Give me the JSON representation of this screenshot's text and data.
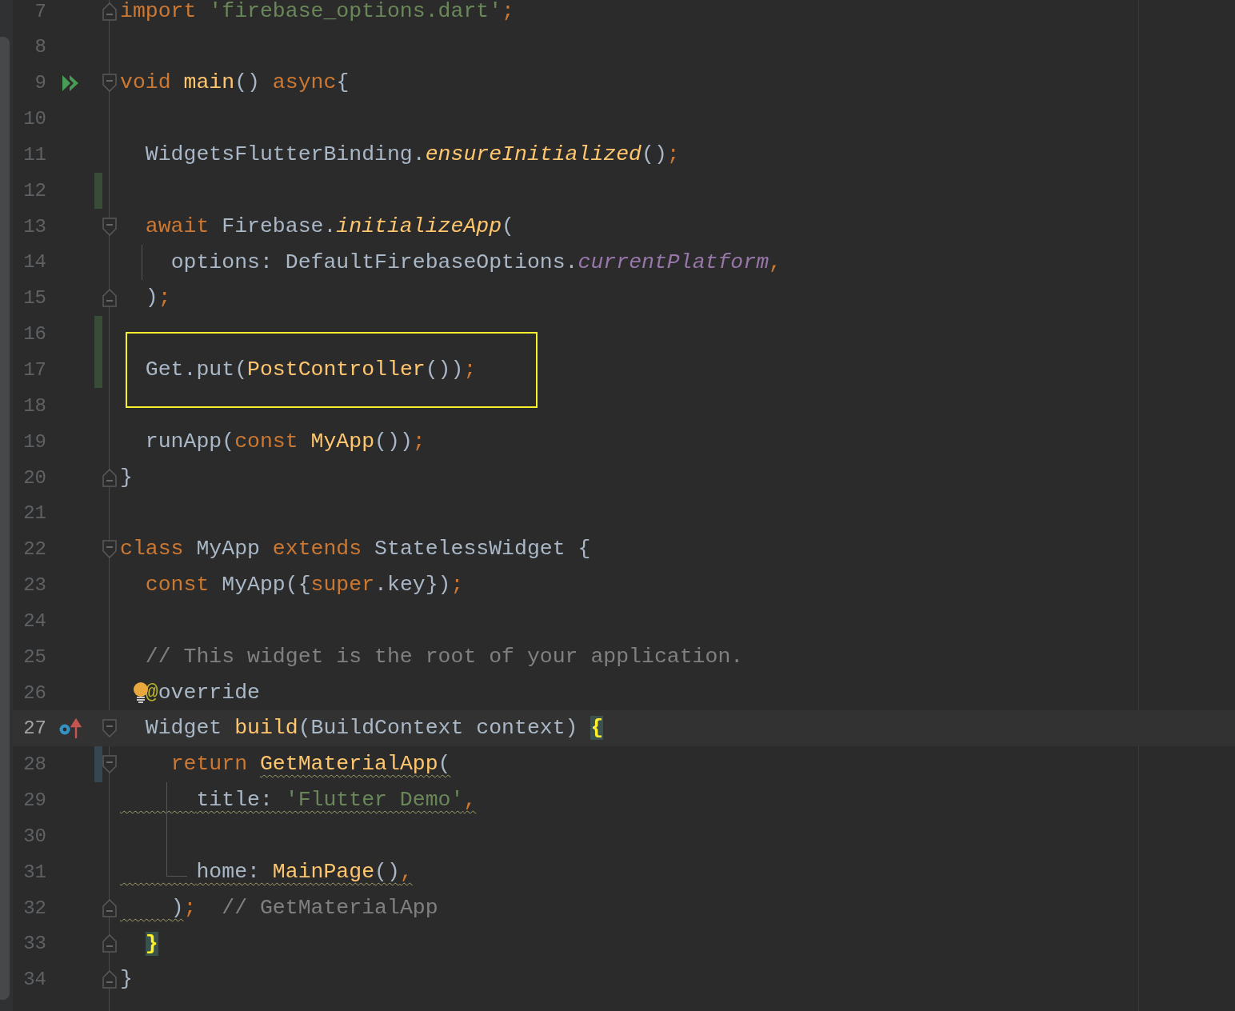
{
  "editor": {
    "lines": [
      {
        "number": "7",
        "current": false,
        "boxed": false,
        "fold": {
          "kind": "end"
        },
        "tokens": [
          {
            "kind": "keyword",
            "text": "import"
          },
          {
            "kind": "string",
            "text": " 'firebase_options.dart'"
          },
          {
            "kind": "keyword",
            "text": ";"
          }
        ]
      },
      {
        "number": "8",
        "current": false,
        "boxed": false
      },
      {
        "number": "9",
        "current": false,
        "boxed": false,
        "fold": {
          "kind": "start"
        },
        "gutter_icon": {
          "kind": "run"
        },
        "tokens": [
          {
            "kind": "keyword",
            "text": "void"
          },
          {
            "kind": "function",
            "text": " main"
          },
          {
            "kind": "plain",
            "text": "() "
          },
          {
            "kind": "keyword",
            "text": "async"
          },
          {
            "kind": "plain",
            "text": "{"
          }
        ]
      },
      {
        "number": "10",
        "current": false,
        "boxed": false
      },
      {
        "number": "11",
        "current": false,
        "boxed": false,
        "tokens": [
          {
            "kind": "plain",
            "text": "  WidgetsFlutterBinding."
          },
          {
            "kind": "static_call",
            "text": "ensureInitialized"
          },
          {
            "kind": "plain",
            "text": "()"
          },
          {
            "kind": "keyword",
            "text": ";"
          }
        ]
      },
      {
        "number": "12",
        "current": false,
        "boxed": false,
        "change": {
          "kind": "added"
        }
      },
      {
        "number": "13",
        "current": false,
        "boxed": false,
        "fold": {
          "kind": "start"
        },
        "tokens": [
          {
            "kind": "keyword",
            "text": "  await"
          },
          {
            "kind": "plain",
            "text": " Firebase."
          },
          {
            "kind": "static_call",
            "text": "initializeApp"
          },
          {
            "kind": "plain",
            "text": "("
          }
        ]
      },
      {
        "number": "14",
        "current": false,
        "boxed": false,
        "guide": {
          "kind": "line"
        },
        "tokens": [
          {
            "kind": "plain",
            "text": "    options: DefaultFirebaseOptions."
          },
          {
            "kind": "static_field",
            "text": "currentPlatform"
          },
          {
            "kind": "keyword",
            "text": ","
          }
        ]
      },
      {
        "number": "15",
        "current": false,
        "boxed": false,
        "fold": {
          "kind": "end"
        },
        "tokens": [
          {
            "kind": "plain",
            "text": "  )"
          },
          {
            "kind": "keyword",
            "text": ";"
          }
        ]
      },
      {
        "number": "16",
        "current": false,
        "boxed": true,
        "change": {
          "kind": "added"
        }
      },
      {
        "number": "17",
        "current": false,
        "boxed": true,
        "change": {
          "kind": "added"
        },
        "tokens": [
          {
            "kind": "plain",
            "text": "  Get.put("
          },
          {
            "kind": "function",
            "text": "PostController"
          },
          {
            "kind": "plain",
            "text": "())"
          },
          {
            "kind": "keyword",
            "text": ";"
          }
        ]
      },
      {
        "number": "18",
        "current": false,
        "boxed": true
      },
      {
        "number": "19",
        "current": false,
        "boxed": false,
        "tokens": [
          {
            "kind": "plain",
            "text": "  runApp("
          },
          {
            "kind": "keyword",
            "text": "const"
          },
          {
            "kind": "function",
            "text": " MyApp"
          },
          {
            "kind": "plain",
            "text": "())"
          },
          {
            "kind": "keyword",
            "text": ";"
          }
        ]
      },
      {
        "number": "20",
        "current": false,
        "boxed": false,
        "fold": {
          "kind": "end"
        },
        "tokens": [
          {
            "kind": "plain",
            "text": "}"
          }
        ]
      },
      {
        "number": "21",
        "current": false,
        "boxed": false
      },
      {
        "number": "22",
        "current": false,
        "boxed": false,
        "fold": {
          "kind": "start"
        },
        "tokens": [
          {
            "kind": "keyword",
            "text": "class"
          },
          {
            "kind": "plain",
            "text": " MyApp "
          },
          {
            "kind": "keyword",
            "text": "extends"
          },
          {
            "kind": "plain",
            "text": " StatelessWidget {"
          }
        ]
      },
      {
        "number": "23",
        "current": false,
        "boxed": false,
        "tokens": [
          {
            "kind": "keyword",
            "text": "  const"
          },
          {
            "kind": "plain",
            "text": " MyApp({"
          },
          {
            "kind": "keyword",
            "text": "super"
          },
          {
            "kind": "plain",
            "text": ".key})"
          },
          {
            "kind": "keyword",
            "text": ";"
          }
        ]
      },
      {
        "number": "24",
        "current": false,
        "boxed": false
      },
      {
        "number": "25",
        "current": false,
        "boxed": false,
        "tokens": [
          {
            "kind": "comment",
            "text": "  // This widget is the root of your application."
          }
        ]
      },
      {
        "number": "26",
        "current": false,
        "boxed": false,
        "bulb": true,
        "tokens": [
          {
            "kind": "annotation",
            "text": "  @"
          },
          {
            "kind": "plain",
            "text": "override"
          }
        ]
      },
      {
        "number": "27",
        "current": true,
        "boxed": false,
        "fold": {
          "kind": "start"
        },
        "gutter_icon": {
          "kind": "override"
        },
        "tokens": [
          {
            "kind": "plain",
            "text": "  Widget "
          },
          {
            "kind": "function",
            "text": "build"
          },
          {
            "kind": "plain",
            "text": "(BuildContext context)"
          },
          {
            "kind": "brace",
            "text": " {",
            "matched": true
          }
        ]
      },
      {
        "number": "28",
        "current": false,
        "boxed": false,
        "fold": {
          "kind": "start"
        },
        "change": {
          "kind": "modified"
        },
        "tokens": [
          {
            "kind": "keyword",
            "text": "    return"
          },
          {
            "kind": "function",
            "text": " GetMaterialApp",
            "warning": true
          },
          {
            "kind": "plain",
            "text": "(",
            "warning": true
          }
        ]
      },
      {
        "number": "29",
        "current": false,
        "boxed": false,
        "guide": {
          "kind": "line"
        },
        "tokens": [
          {
            "kind": "plain",
            "text": "      title: ",
            "warning": true
          },
          {
            "kind": "string",
            "text": "'Flutter Demo'",
            "warning": true
          },
          {
            "kind": "keyword",
            "text": ",",
            "warning": true
          }
        ]
      },
      {
        "number": "30",
        "current": false,
        "boxed": false,
        "guide": {
          "kind": "line"
        }
      },
      {
        "number": "31",
        "current": false,
        "boxed": false,
        "guide": {
          "kind": "elbow"
        },
        "tokens": [
          {
            "kind": "plain",
            "text": "      home: ",
            "warning": true
          },
          {
            "kind": "function",
            "text": "MainPage",
            "warning": true
          },
          {
            "kind": "plain",
            "text": "()",
            "warning": true
          },
          {
            "kind": "keyword",
            "text": ",",
            "warning": true
          }
        ]
      },
      {
        "number": "32",
        "current": false,
        "boxed": false,
        "fold": {
          "kind": "end"
        },
        "tokens": [
          {
            "kind": "plain",
            "text": "    )",
            "warning": true
          },
          {
            "kind": "keyword",
            "text": ";"
          },
          {
            "kind": "comment",
            "text": "  // GetMaterialApp"
          }
        ]
      },
      {
        "number": "33",
        "current": false,
        "boxed": false,
        "fold": {
          "kind": "end"
        },
        "tokens": [
          {
            "kind": "brace",
            "text": "  }",
            "matched": true
          }
        ]
      },
      {
        "number": "34",
        "current": false,
        "boxed": false,
        "fold": {
          "kind": "end"
        },
        "tokens": [
          {
            "kind": "plain",
            "text": "}"
          }
        ]
      }
    ]
  }
}
